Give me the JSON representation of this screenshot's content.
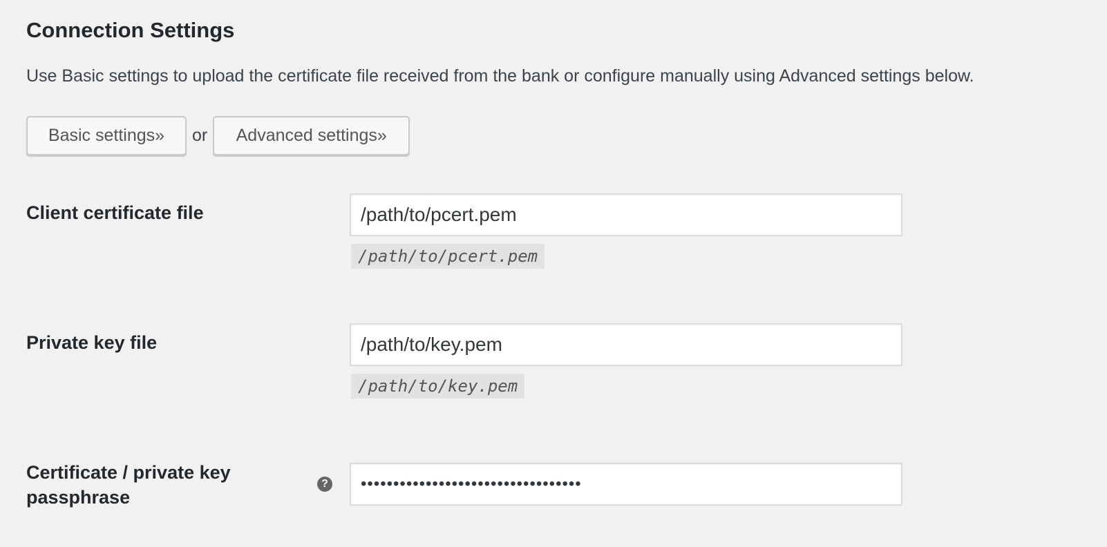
{
  "section": {
    "title": "Connection Settings",
    "description": "Use Basic settings to upload the certificate file received from the bank or configure manually using Advanced settings below."
  },
  "mode_buttons": {
    "basic_label": "Basic settings»",
    "separator": "or",
    "advanced_label": "Advanced settings»"
  },
  "fields": {
    "client_cert": {
      "label": "Client certificate file",
      "value": "/path/to/pcert.pem",
      "hint": "/path/to/pcert.pem"
    },
    "private_key": {
      "label": "Private key file",
      "value": "/path/to/key.pem",
      "hint": "/path/to/key.pem"
    },
    "passphrase": {
      "label": "Certificate / private key passphrase",
      "value": "••••••••••••••••••••••••••••••••••",
      "help_icon": "question-circle-icon",
      "help_glyph": "?"
    }
  }
}
